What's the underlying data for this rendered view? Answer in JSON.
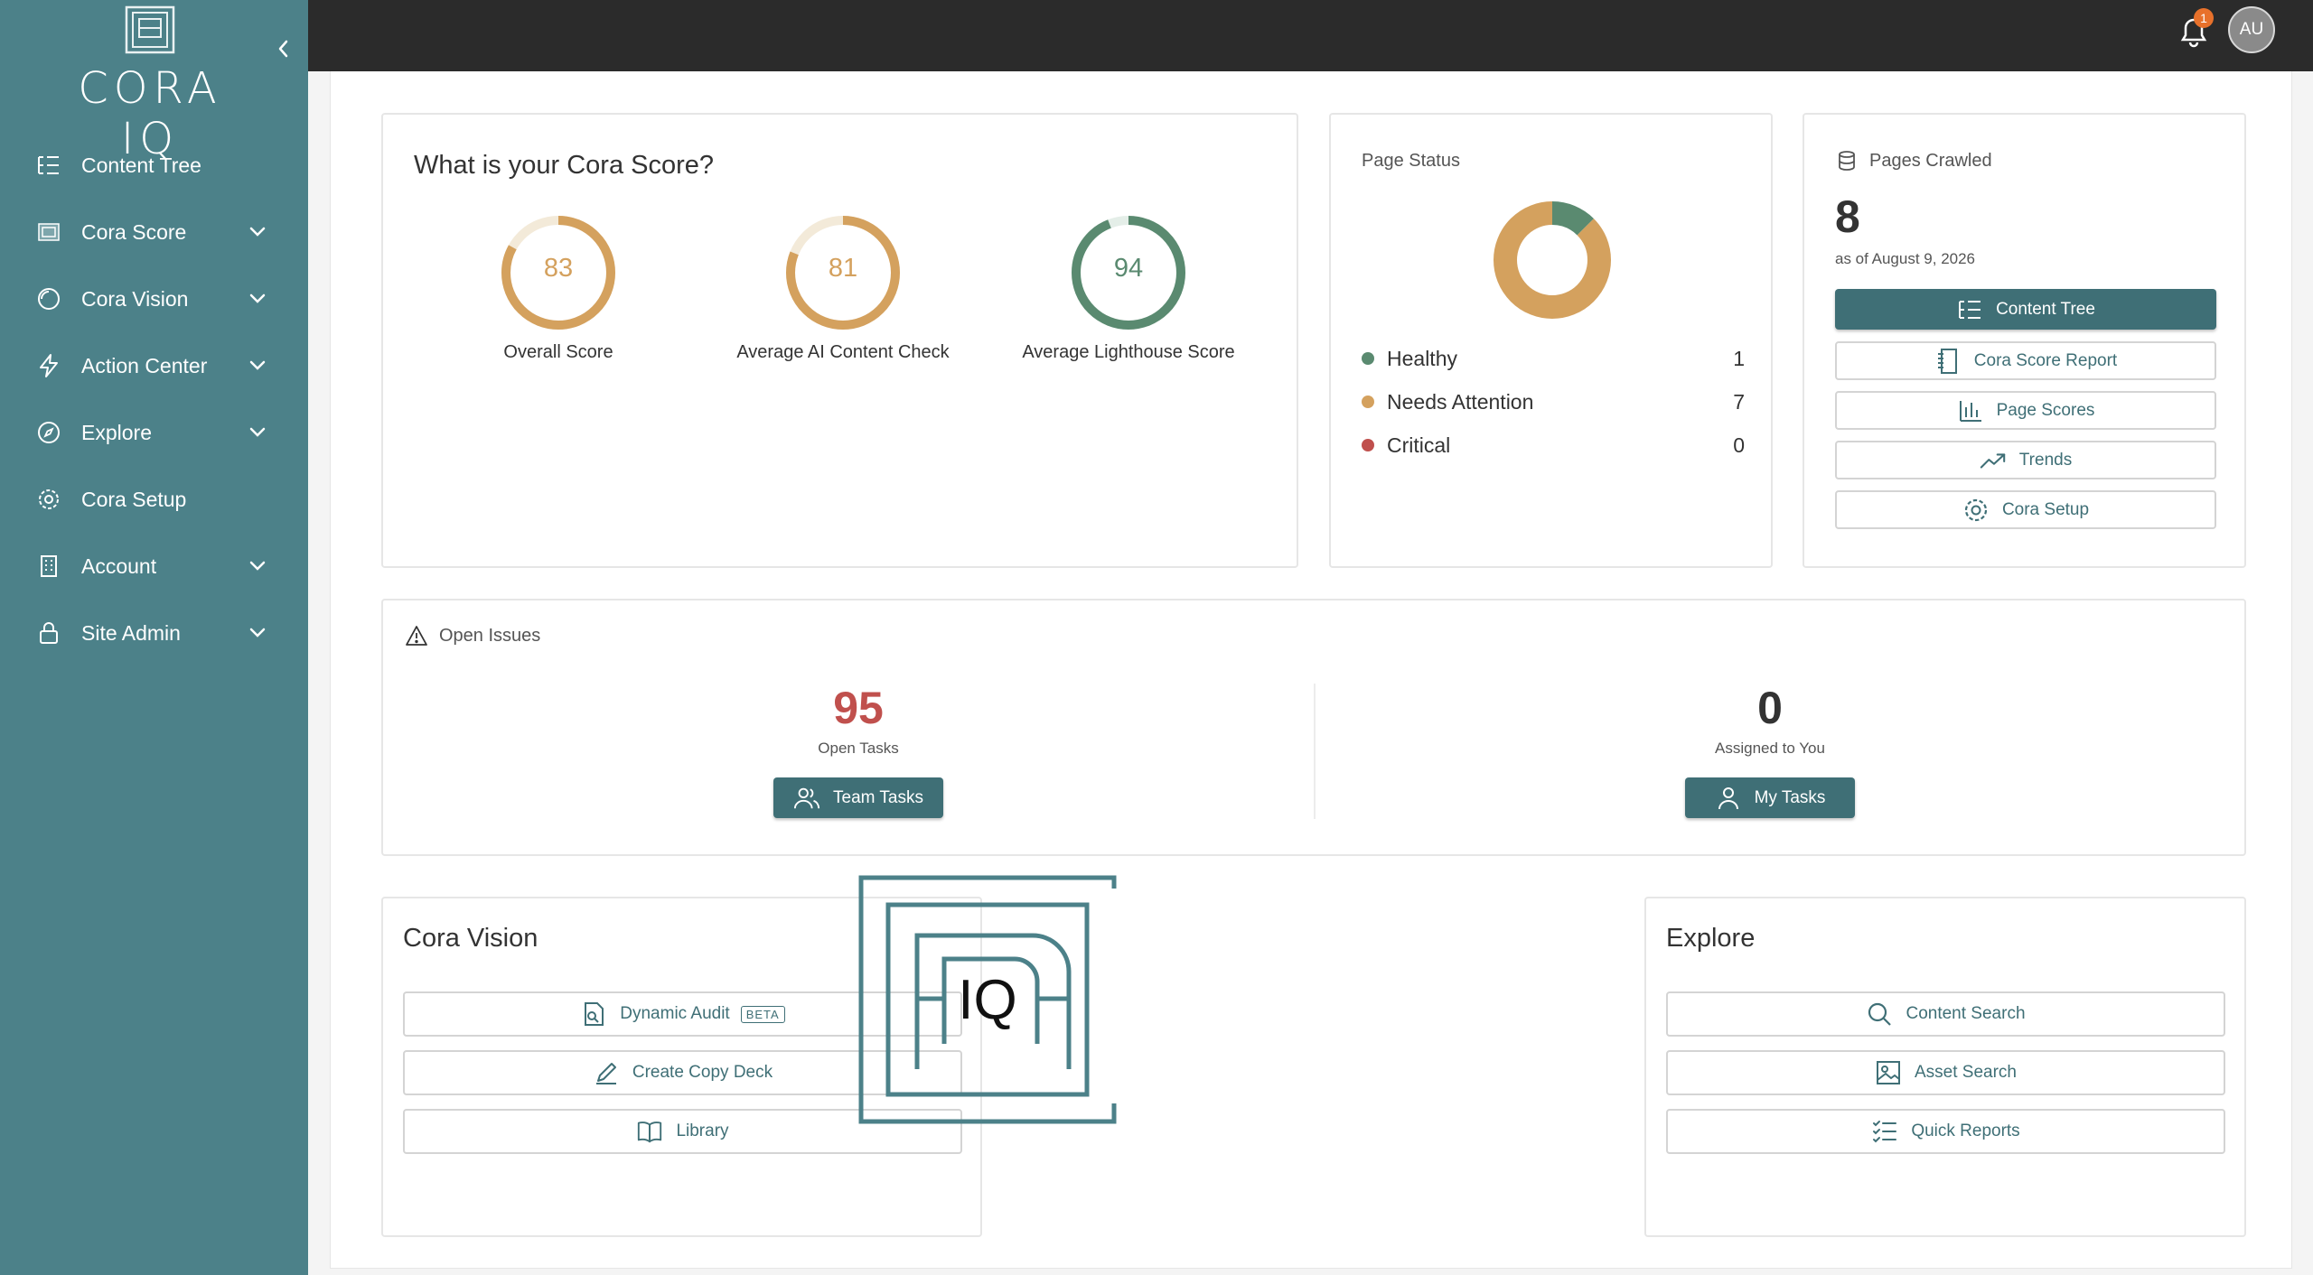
{
  "app": {
    "brand": "CORA IQ",
    "accent": "#3f6f76",
    "sidebar_color": "#4c8189"
  },
  "sidebar": {
    "items": [
      {
        "label": "Content Tree",
        "icon": "tree-list-icon",
        "has_chevron": false
      },
      {
        "label": "Cora Score",
        "icon": "score-icon",
        "has_chevron": true
      },
      {
        "label": "Cora Vision",
        "icon": "vision-icon",
        "has_chevron": true
      },
      {
        "label": "Action Center",
        "icon": "lightning-icon",
        "has_chevron": true
      },
      {
        "label": "Explore",
        "icon": "compass-icon",
        "has_chevron": true
      },
      {
        "label": "Cora Setup",
        "icon": "gear-icon",
        "has_chevron": false
      },
      {
        "label": "Account",
        "icon": "building-icon",
        "has_chevron": true
      },
      {
        "label": "Site Admin",
        "icon": "lock-icon",
        "has_chevron": true
      }
    ]
  },
  "topbar": {
    "notification_count": "1",
    "avatar_initials": "AU"
  },
  "score_card": {
    "title": "What is your Cora Score?",
    "gauges": [
      {
        "value": "83",
        "label": "Overall Score",
        "percent": 83,
        "color": "#d4a15e"
      },
      {
        "value": "81",
        "label": "Average AI Content Check",
        "percent": 81,
        "color": "#d4a15e"
      },
      {
        "value": "94",
        "label": "Average Lighthouse Score",
        "percent": 94,
        "color": "#5a8a70"
      }
    ]
  },
  "page_status": {
    "title": "Page Status",
    "items": [
      {
        "label": "Healthy",
        "count": "1",
        "value": 1,
        "color": "#5a8a70"
      },
      {
        "label": "Needs Attention",
        "count": "7",
        "value": 7,
        "color": "#d4a15e"
      },
      {
        "label": "Critical",
        "count": "0",
        "value": 0,
        "color": "#c0504d"
      }
    ]
  },
  "pages_crawled": {
    "title": "Pages Crawled",
    "count": "8",
    "as_of": "as of August 9, 2026",
    "buttons": [
      {
        "label": "Content Tree",
        "icon": "tree-list-icon",
        "primary": true
      },
      {
        "label": "Cora Score Report",
        "icon": "notebook-icon",
        "primary": false
      },
      {
        "label": "Page Scores",
        "icon": "bar-chart-icon",
        "primary": false
      },
      {
        "label": "Trends",
        "icon": "trend-up-icon",
        "primary": false
      },
      {
        "label": "Cora Setup",
        "icon": "gear-icon",
        "primary": false
      }
    ]
  },
  "open_issues": {
    "title": "Open Issues",
    "open_tasks": {
      "count": "95",
      "label": "Open Tasks",
      "button": "Team Tasks",
      "color": "#c0504d"
    },
    "assigned": {
      "count": "0",
      "label": "Assigned to You",
      "button": "My Tasks",
      "color": "#333333"
    }
  },
  "cora_vision": {
    "title": "Cora Vision",
    "buttons": [
      {
        "label": "Dynamic Audit",
        "badge": "BETA",
        "icon": "document-search-icon"
      },
      {
        "label": "Create Copy Deck",
        "icon": "pencil-icon"
      },
      {
        "label": "Library",
        "icon": "book-icon"
      }
    ]
  },
  "explore": {
    "title": "Explore",
    "buttons": [
      {
        "label": "Content Search",
        "icon": "search-icon"
      },
      {
        "label": "Asset Search",
        "icon": "image-icon"
      },
      {
        "label": "Quick Reports",
        "icon": "checklist-icon"
      }
    ]
  },
  "center_logo": {
    "text": "IQ"
  }
}
